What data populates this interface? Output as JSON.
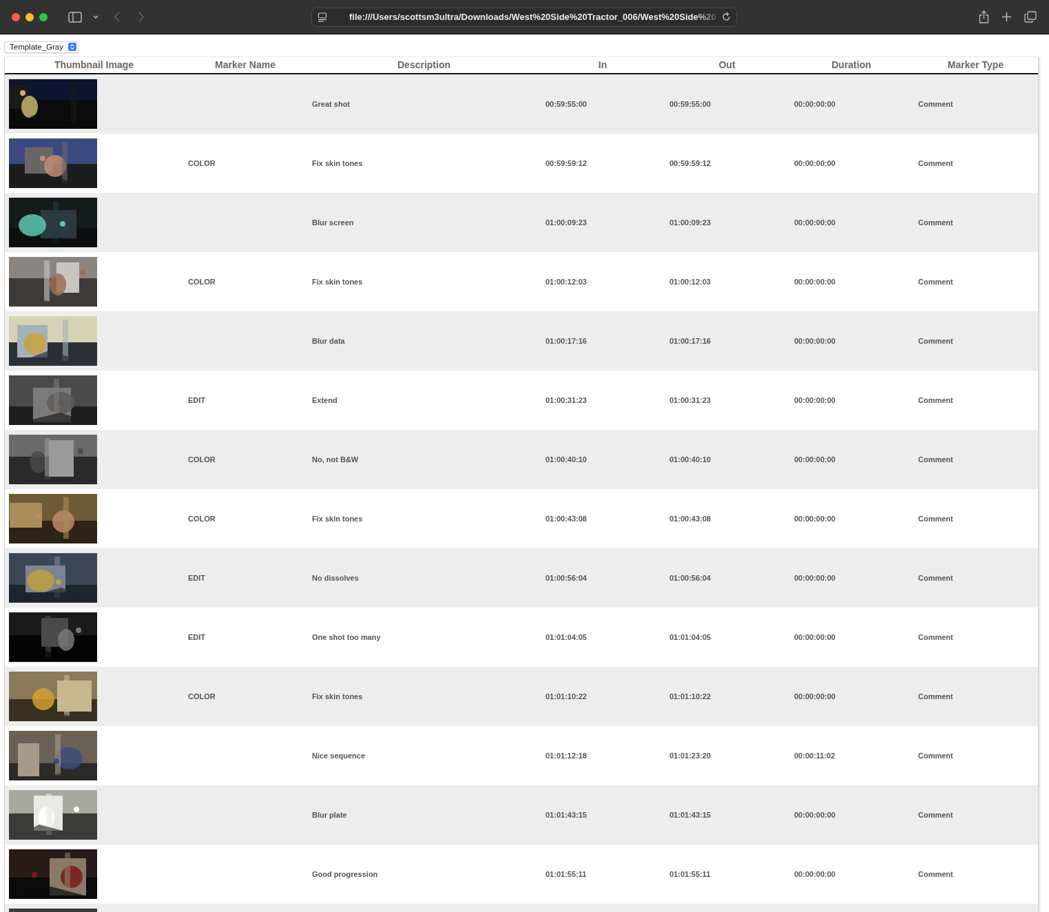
{
  "browser": {
    "url": "file:///Users/scottsm3ultra/Downloads/West%20Side%20Tractor_006/West%20Side%20"
  },
  "template_select": {
    "value": "Template_Gray"
  },
  "table": {
    "columns": [
      "Thumbnail Image",
      "Marker Name",
      "Description",
      "In",
      "Out",
      "Duration",
      "Marker Type"
    ],
    "rows": [
      {
        "thumbnail": {
          "kind": "picture"
        },
        "description": "Great shot",
        "in": "00:59:55:00",
        "out": "00:59:55:00",
        "duration": "00:00:00:00",
        "marker_type": "Comment"
      },
      {
        "thumbnail": {
          "kind": "picture"
        },
        "marker_name": "COLOR",
        "description": "Fix skin tones",
        "in": "00:59:59:12",
        "out": "00:59:59:12",
        "duration": "00:00:00:00",
        "marker_type": "Comment"
      },
      {
        "thumbnail": {
          "kind": "picture"
        },
        "description": "Blur screen",
        "in": "01:00:09:23",
        "out": "01:00:09:23",
        "duration": "00:00:00:00",
        "marker_type": "Comment"
      },
      {
        "thumbnail": {
          "kind": "picture"
        },
        "marker_name": "COLOR",
        "description": "Fix skin tones",
        "in": "01:00:12:03",
        "out": "01:00:12:03",
        "duration": "00:00:00:00",
        "marker_type": "Comment"
      },
      {
        "thumbnail": {
          "kind": "picture"
        },
        "description": "Blur data",
        "in": "01:00:17:16",
        "out": "01:00:17:16",
        "duration": "00:00:00:00",
        "marker_type": "Comment"
      },
      {
        "thumbnail": {
          "kind": "picture"
        },
        "marker_name": "EDIT",
        "description": "Extend",
        "in": "01:00:31:23",
        "out": "01:00:31:23",
        "duration": "00:00:00:00",
        "marker_type": "Comment"
      },
      {
        "thumbnail": {
          "kind": "picture"
        },
        "marker_name": "COLOR",
        "description": "No, not B&W",
        "in": "01:00:40:10",
        "out": "01:00:40:10",
        "duration": "00:00:00:00",
        "marker_type": "Comment"
      },
      {
        "thumbnail": {
          "kind": "picture"
        },
        "marker_name": "COLOR",
        "description": "Fix skin tones",
        "in": "01:00:43:08",
        "out": "01:00:43:08",
        "duration": "00:00:00:00",
        "marker_type": "Comment"
      },
      {
        "thumbnail": {
          "kind": "picture"
        },
        "marker_name": "EDIT",
        "description": "No dissolves",
        "in": "01:00:56:04",
        "out": "01:00:56:04",
        "duration": "00:00:00:00",
        "marker_type": "Comment"
      },
      {
        "thumbnail": {
          "kind": "picture"
        },
        "marker_name": "EDIT",
        "description": "One shot too many",
        "in": "01:01:04:05",
        "out": "01:01:04:05",
        "duration": "00:00:00:00",
        "marker_type": "Comment"
      },
      {
        "thumbnail": {
          "kind": "picture"
        },
        "marker_name": "COLOR",
        "description": "Fix skin tones",
        "in": "01:01:10:22",
        "out": "01:01:10:22",
        "duration": "00:00:00:00",
        "marker_type": "Comment"
      },
      {
        "thumbnail": {
          "kind": "picture"
        },
        "description": "Nice sequence",
        "in": "01:01:12:18",
        "out": "01:01:23:20",
        "duration": "00:00:11:02",
        "marker_type": "Comment"
      },
      {
        "thumbnail": {
          "kind": "picture"
        },
        "description": "Blur plate",
        "in": "01:01:43:15",
        "out": "01:01:43:15",
        "duration": "00:00:00:00",
        "marker_type": "Comment"
      },
      {
        "thumbnail": {
          "kind": "picture"
        },
        "description": "Good progression",
        "in": "01:01:55:11",
        "out": "01:01:55:11",
        "duration": "00:00:00:00",
        "marker_type": "Comment"
      },
      {
        "thumbnail": {
          "kind": "picture"
        }
      }
    ]
  }
}
